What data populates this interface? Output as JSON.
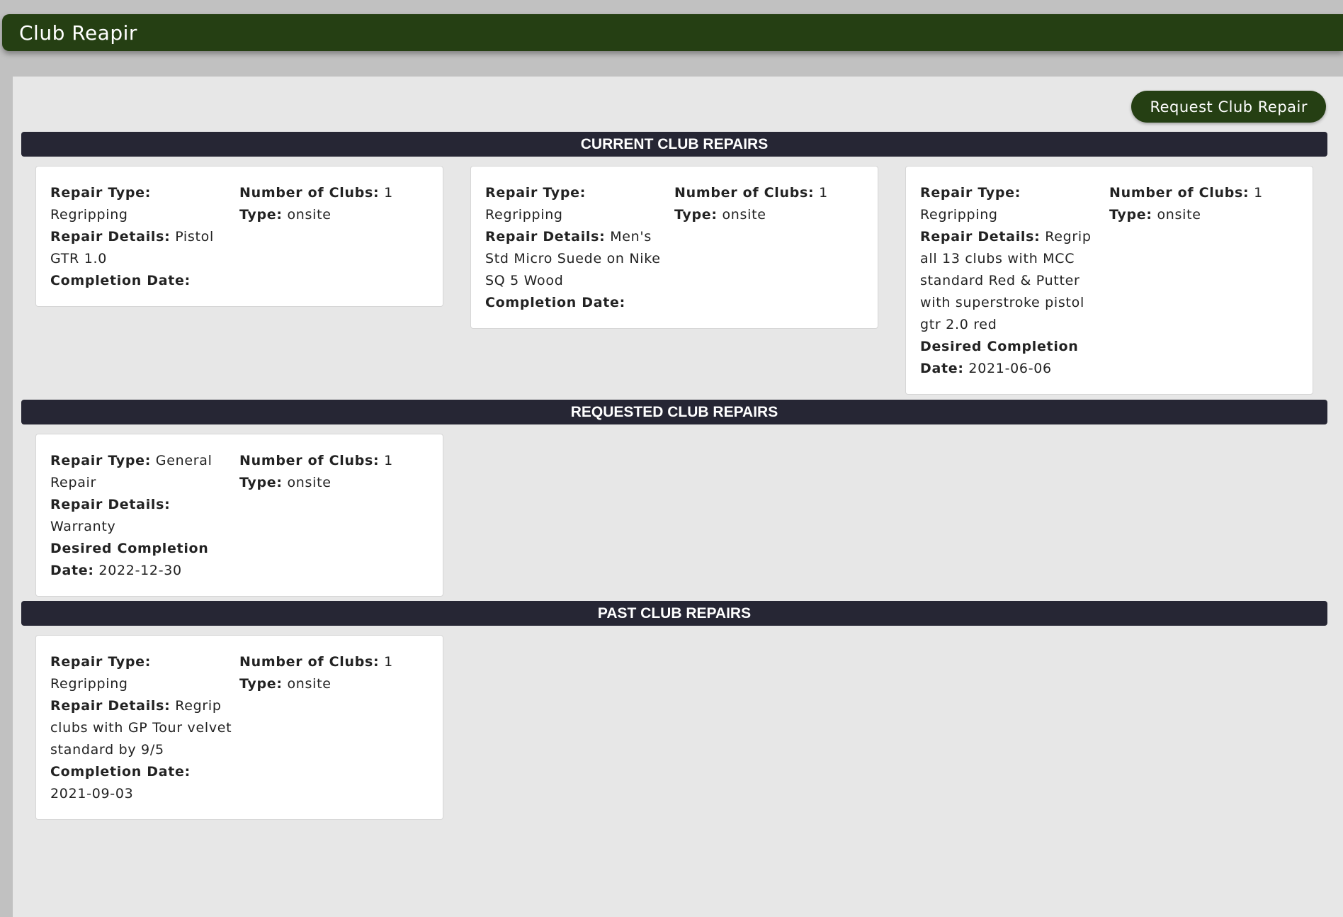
{
  "app": {
    "title": "Club Reapir"
  },
  "actions": {
    "request_label": "Request Club Repair"
  },
  "labels": {
    "repair_type": "Repair Type:",
    "repair_details": "Repair Details:",
    "completion_date": "Completion Date:",
    "desired_completion_date": "Desired Completion Date:",
    "number_of_clubs": "Number of Clubs:",
    "type": "Type:"
  },
  "sections": {
    "current": {
      "title": "CURRENT CLUB REPAIRS",
      "cards": [
        {
          "repair_type": "Regripping",
          "repair_details": "Pistol GTR 1.0",
          "date": "",
          "number_of_clubs": "1",
          "type": "onsite"
        },
        {
          "repair_type": "Regripping",
          "repair_details": "Men's Std Micro Suede on Nike SQ 5 Wood",
          "date": "",
          "number_of_clubs": "1",
          "type": "onsite"
        },
        {
          "repair_type": "Regripping",
          "repair_details": "Regrip all 13 clubs with MCC standard Red & Putter with superstroke pistol gtr 2.0 red",
          "date": "2021-06-06",
          "number_of_clubs": "1",
          "type": "onsite"
        }
      ]
    },
    "requested": {
      "title": "REQUESTED CLUB REPAIRS",
      "cards": [
        {
          "repair_type": "General Repair",
          "repair_details": "Warranty",
          "date": "2022-12-30",
          "number_of_clubs": "1",
          "type": "onsite"
        }
      ]
    },
    "past": {
      "title": "PAST CLUB REPAIRS",
      "cards": [
        {
          "repair_type": "Regripping",
          "repair_details": "Regrip clubs with GP Tour velvet standard by 9/5",
          "date": "2021-09-03",
          "number_of_clubs": "1",
          "type": "onsite"
        }
      ]
    }
  }
}
